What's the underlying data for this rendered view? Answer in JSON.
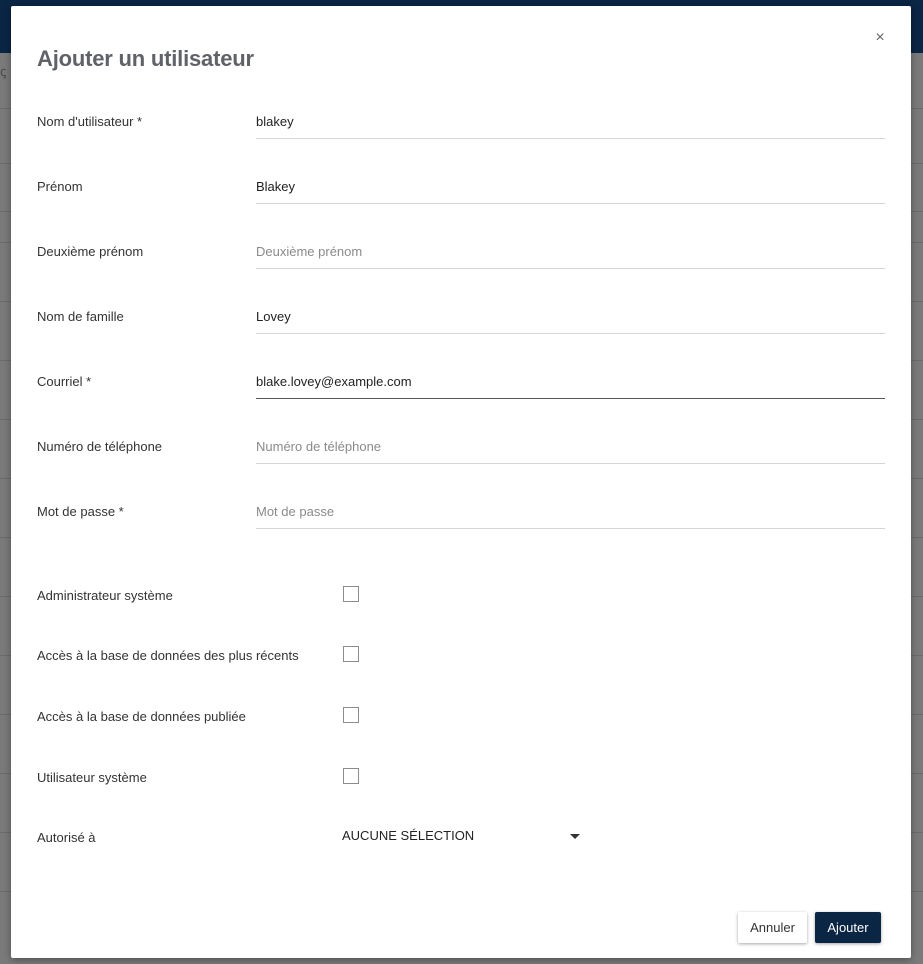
{
  "dialog": {
    "title": "Ajouter un utilisateur",
    "close_symbol": "×"
  },
  "fields": [
    {
      "label": "Nom d'utilisateur *",
      "value": "blakey",
      "placeholder": "Nom d'utilisateur"
    },
    {
      "label": "Prénom",
      "value": "Blakey",
      "placeholder": "Prénom"
    },
    {
      "label": "Deuxième prénom",
      "value": "",
      "placeholder": "Deuxième prénom"
    },
    {
      "label": "Nom de famille",
      "value": "Lovey",
      "placeholder": "Nom de famille"
    },
    {
      "label": "Courriel *",
      "value": "blake.lovey@example.com",
      "placeholder": "Courriel"
    },
    {
      "label": "Numéro de téléphone",
      "value": "",
      "placeholder": "Numéro de téléphone"
    },
    {
      "label": "Mot de passe *",
      "value": "",
      "placeholder": "Mot de passe"
    }
  ],
  "checkboxes": [
    {
      "label": "Administrateur système",
      "checked": false
    },
    {
      "label": "Accès à la base de données des plus récents",
      "checked": false
    },
    {
      "label": "Accès à la base de données publiée",
      "checked": false
    },
    {
      "label": "Utilisateur système",
      "checked": false
    }
  ],
  "authorized": {
    "label": "Autorisé à",
    "selected": "AUCUNE SÉLECTION"
  },
  "actions": {
    "cancel_label": "Annuler",
    "add_label": "Ajouter"
  },
  "colors": {
    "brand_dark": "#0b2545",
    "overlay": "#7a7a7a"
  },
  "icons": {
    "close": "close-icon",
    "caret": "caret-down-icon"
  }
}
